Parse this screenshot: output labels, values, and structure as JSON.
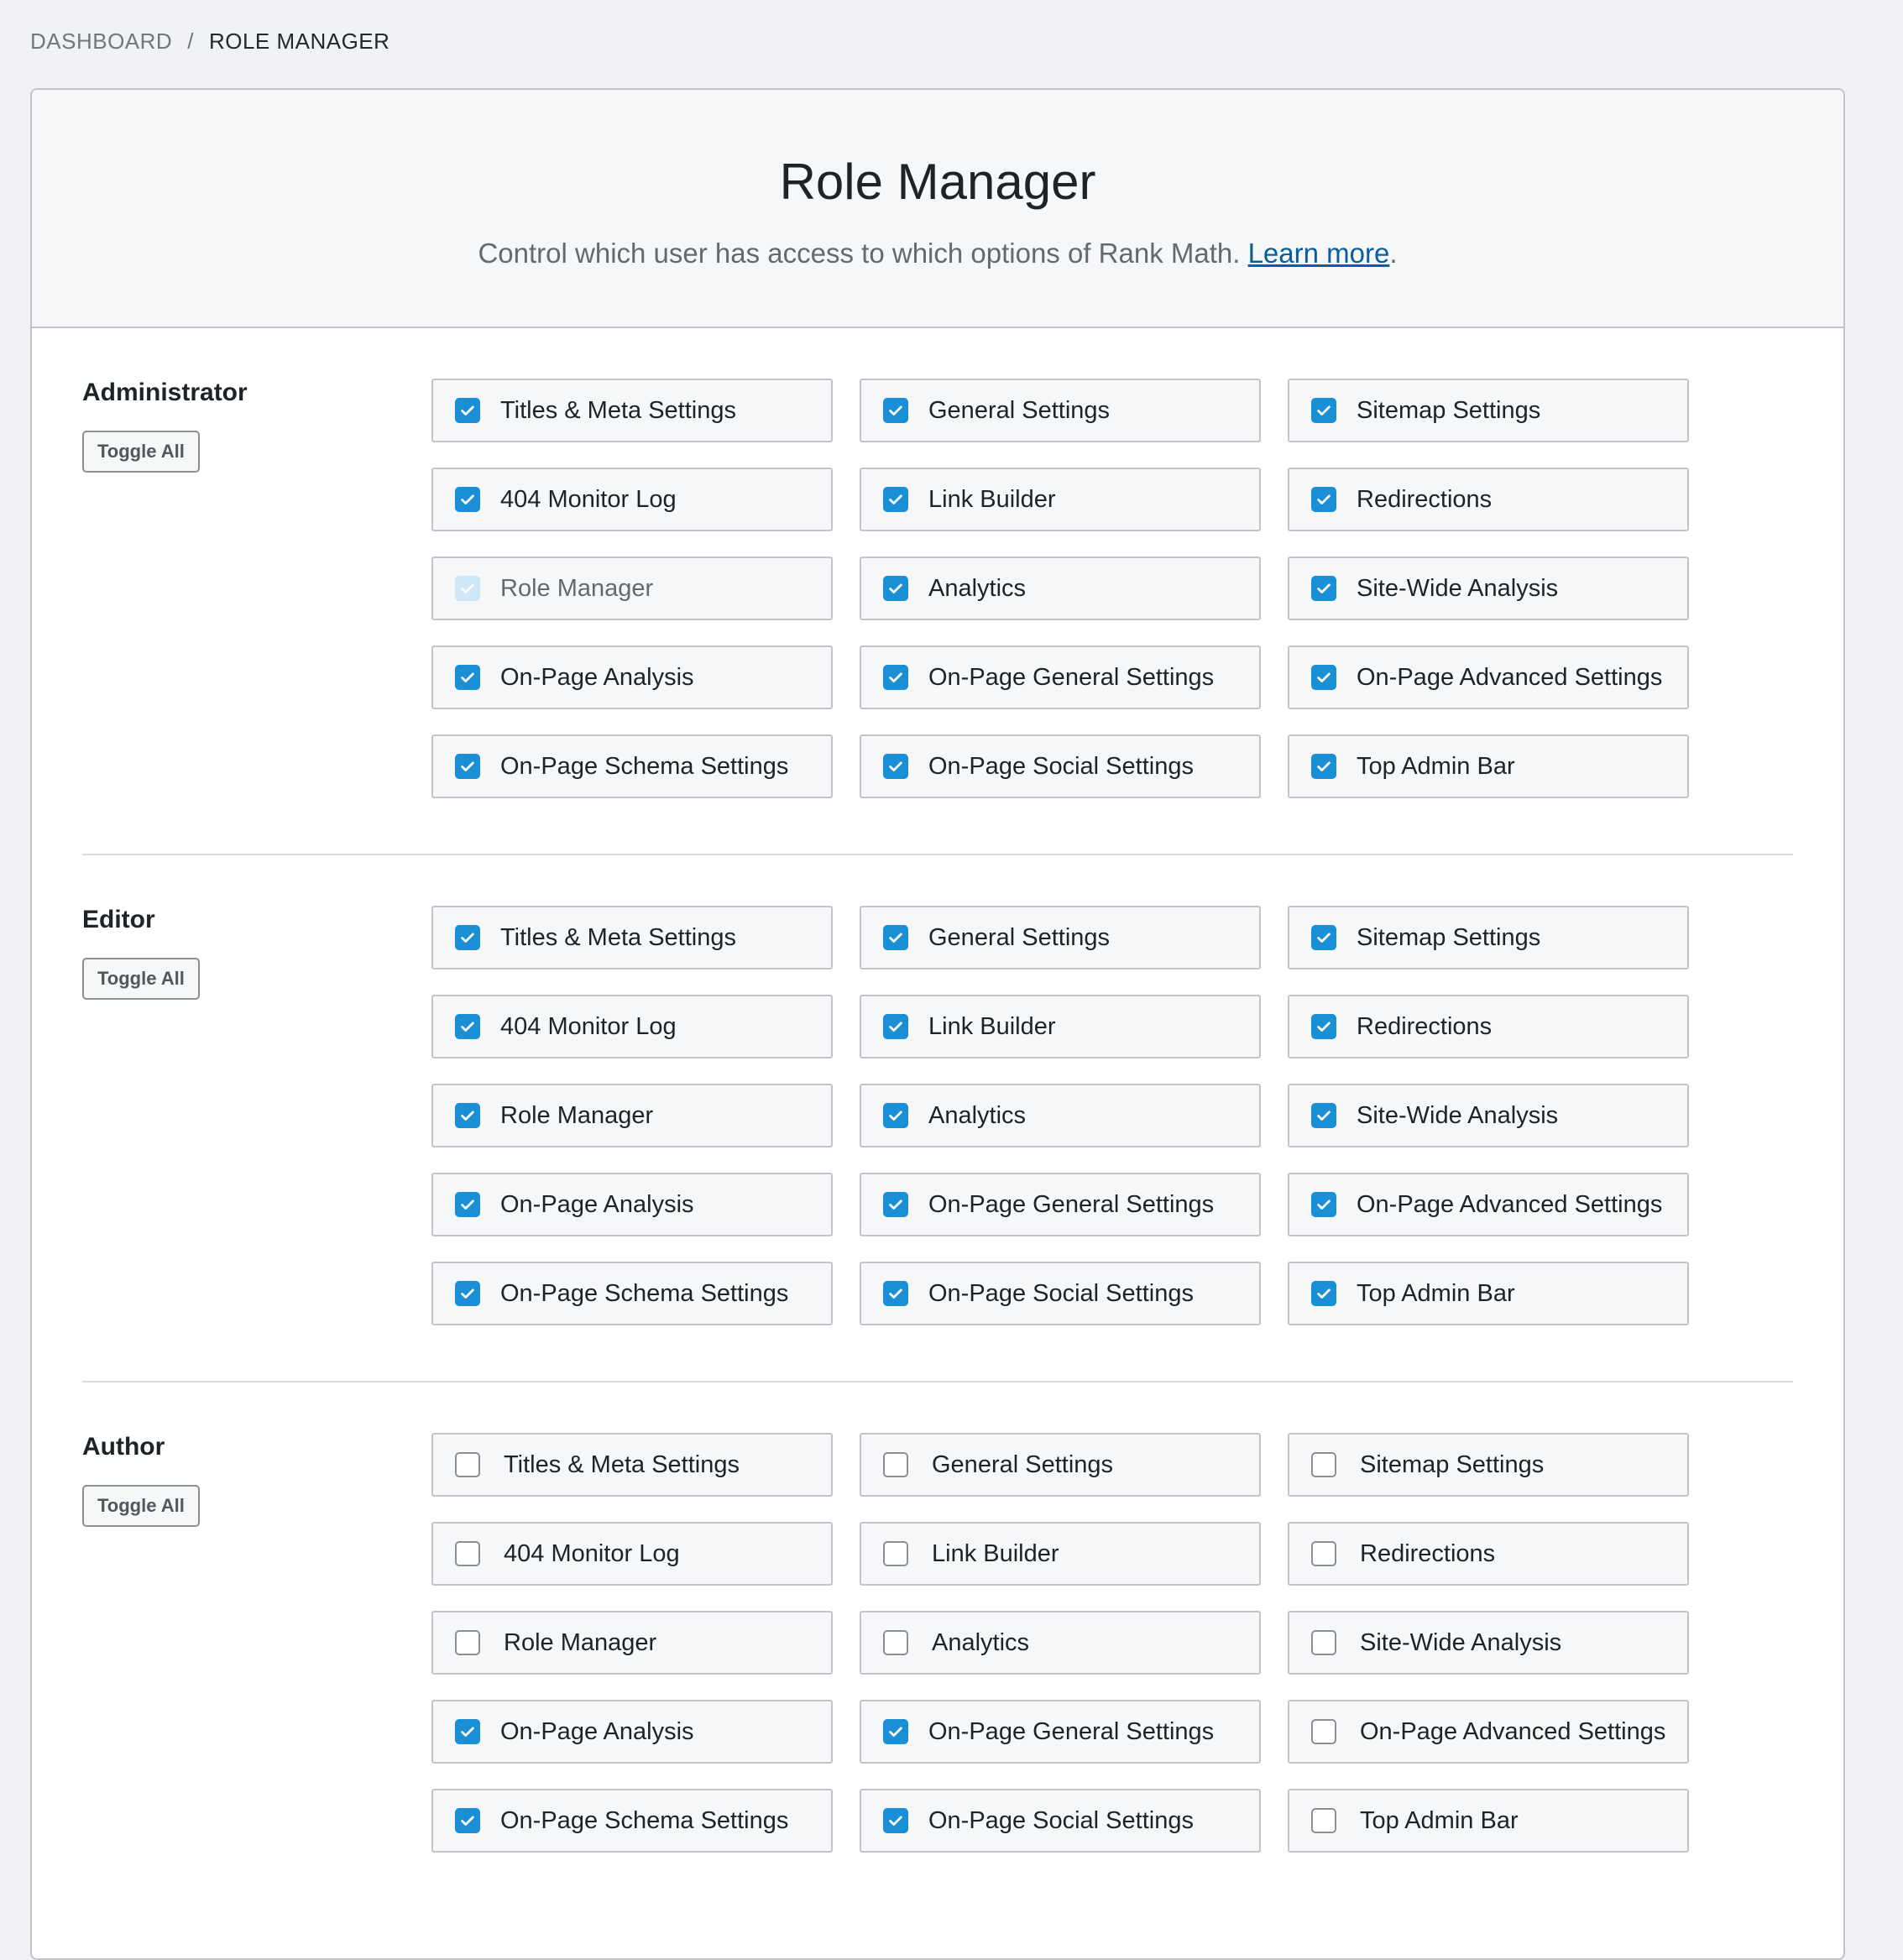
{
  "breadcrumb": {
    "parent": "DASHBOARD",
    "separator": "/",
    "current": "ROLE MANAGER"
  },
  "header": {
    "title": "Role Manager",
    "description": "Control which user has access to which options of Rank Math.",
    "learn_more": "Learn more",
    "trailing": "."
  },
  "colors": {
    "checkbox_checked": "#1a8fd6",
    "checkbox_disabled": "#cfe7f6",
    "link": "#0a5e9c"
  },
  "roles": [
    {
      "name": "Administrator",
      "toggle_label": "Toggle All",
      "capabilities": [
        {
          "label": "Titles & Meta Settings",
          "state": "checked"
        },
        {
          "label": "General Settings",
          "state": "checked"
        },
        {
          "label": "Sitemap Settings",
          "state": "checked"
        },
        {
          "label": "404 Monitor Log",
          "state": "checked"
        },
        {
          "label": "Link Builder",
          "state": "checked"
        },
        {
          "label": "Redirections",
          "state": "checked"
        },
        {
          "label": "Role Manager",
          "state": "disabled"
        },
        {
          "label": "Analytics",
          "state": "checked"
        },
        {
          "label": "Site-Wide Analysis",
          "state": "checked"
        },
        {
          "label": "On-Page Analysis",
          "state": "checked"
        },
        {
          "label": "On-Page General Settings",
          "state": "checked"
        },
        {
          "label": "On-Page Advanced Settings",
          "state": "checked"
        },
        {
          "label": "On-Page Schema Settings",
          "state": "checked"
        },
        {
          "label": "On-Page Social Settings",
          "state": "checked"
        },
        {
          "label": "Top Admin Bar",
          "state": "checked"
        }
      ]
    },
    {
      "name": "Editor",
      "toggle_label": "Toggle All",
      "capabilities": [
        {
          "label": "Titles & Meta Settings",
          "state": "checked"
        },
        {
          "label": "General Settings",
          "state": "checked"
        },
        {
          "label": "Sitemap Settings",
          "state": "checked"
        },
        {
          "label": "404 Monitor Log",
          "state": "checked"
        },
        {
          "label": "Link Builder",
          "state": "checked"
        },
        {
          "label": "Redirections",
          "state": "checked"
        },
        {
          "label": "Role Manager",
          "state": "checked"
        },
        {
          "label": "Analytics",
          "state": "checked"
        },
        {
          "label": "Site-Wide Analysis",
          "state": "checked"
        },
        {
          "label": "On-Page Analysis",
          "state": "checked"
        },
        {
          "label": "On-Page General Settings",
          "state": "checked"
        },
        {
          "label": "On-Page Advanced Settings",
          "state": "checked"
        },
        {
          "label": "On-Page Schema Settings",
          "state": "checked"
        },
        {
          "label": "On-Page Social Settings",
          "state": "checked"
        },
        {
          "label": "Top Admin Bar",
          "state": "checked"
        }
      ]
    },
    {
      "name": "Author",
      "toggle_label": "Toggle All",
      "capabilities": [
        {
          "label": "Titles & Meta Settings",
          "state": "unchecked"
        },
        {
          "label": "General Settings",
          "state": "unchecked"
        },
        {
          "label": "Sitemap Settings",
          "state": "unchecked"
        },
        {
          "label": "404 Monitor Log",
          "state": "unchecked"
        },
        {
          "label": "Link Builder",
          "state": "unchecked"
        },
        {
          "label": "Redirections",
          "state": "unchecked"
        },
        {
          "label": "Role Manager",
          "state": "unchecked"
        },
        {
          "label": "Analytics",
          "state": "unchecked"
        },
        {
          "label": "Site-Wide Analysis",
          "state": "unchecked"
        },
        {
          "label": "On-Page Analysis",
          "state": "checked"
        },
        {
          "label": "On-Page General Settings",
          "state": "checked"
        },
        {
          "label": "On-Page Advanced Settings",
          "state": "unchecked"
        },
        {
          "label": "On-Page Schema Settings",
          "state": "checked"
        },
        {
          "label": "On-Page Social Settings",
          "state": "checked"
        },
        {
          "label": "Top Admin Bar",
          "state": "unchecked"
        }
      ]
    }
  ]
}
